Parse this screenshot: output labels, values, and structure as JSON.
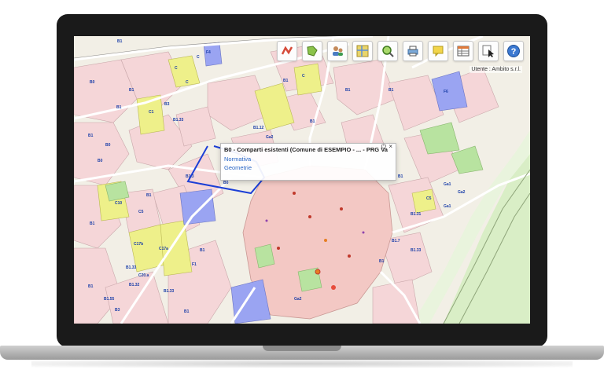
{
  "toolbar": {
    "icons": [
      "map-layers-icon",
      "legend-icon",
      "users-icon",
      "grid-icon",
      "search-icon",
      "print-icon",
      "note-icon",
      "table-icon",
      "pointer-icon",
      "help-icon"
    ],
    "help_label": "?"
  },
  "user": {
    "label": "Utente : Ambito s.r.l."
  },
  "popup": {
    "title": "B0 - Comparti esistenti (Comune di ESEMPIO - ... - PRG Va",
    "links": [
      "Normativa",
      "Geometrie"
    ],
    "close_glyph": "×",
    "power_glyph": "⏻"
  },
  "map_labels": {
    "l1": "B1",
    "l2": "B0",
    "l3": "C",
    "l4": "C",
    "l5": "F4",
    "l6": "B1",
    "l7": "B3",
    "l8": "B1",
    "l9": "C1",
    "l10": "B1.33",
    "l11": "B1",
    "l12": "B0",
    "l13": "C",
    "l14": "B1",
    "l15": "F6",
    "l16": "B1",
    "l17": "B1",
    "l18": "C10",
    "l19": "C5",
    "l20": "B0",
    "l21": "C17b",
    "l22": "C17a",
    "l23": "B1",
    "l24": "B1",
    "l25": "B1.33",
    "l26": "B1",
    "l27": "B1",
    "l28": "Ga1",
    "l29": "C5",
    "l30": "Ga1",
    "l31": "B1.31",
    "l32": "B1.7",
    "l33": "B1",
    "l34": "B1.33",
    "l35": "Ga2",
    "l36": "B3",
    "l37": "B1",
    "l38": "C20.a",
    "l39": "B1.32",
    "l40": "B1.55",
    "l41": "F1",
    "l42": "Ga2",
    "l43": "B1.33",
    "l44": "B1",
    "l45": "B1.3",
    "l46": "C",
    "l47": "B1.12",
    "l48": "Ga2",
    "l49": "B1",
    "l50": "B0"
  },
  "colors": {
    "land": "#f2efe6",
    "residential": "#f5d6d8",
    "historic_center": "#f3c8c4",
    "yellow_zone": "#eef08a",
    "purple_zone": "#9aa4f2",
    "green_zone": "#b8e3a0",
    "highlight": "#1c3fd6",
    "road": "#ffffff",
    "river": "#cfe8b8"
  }
}
